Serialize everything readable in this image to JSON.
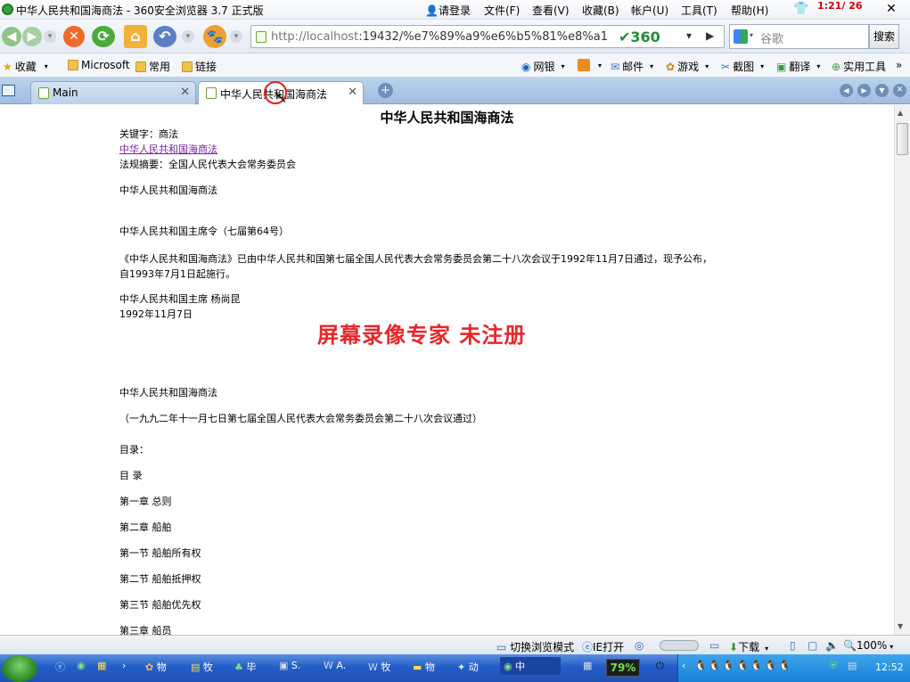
{
  "window": {
    "title": "中华人民共和国海商法 - 360安全浏览器 3.7 正式版",
    "menus": [
      "请登录",
      "文件(F)",
      "查看(V)",
      "收藏(B)",
      "帐户(U)",
      "工具(T)",
      "帮助(H)"
    ],
    "recording_time": "1:21/ 26"
  },
  "navbar": {
    "url_host": "http://localhost",
    "url_rest": ":19432/%e7%89%a9%e6%b5%81%e8%a1",
    "brand": "360",
    "search_placeholder": "谷歌",
    "search_button": "搜索"
  },
  "favorites_bar": {
    "items": [
      "收藏",
      "Microsoft",
      "常用",
      "链接"
    ],
    "right_items": [
      "网银",
      "邮件",
      "游戏",
      "截图",
      "翻译",
      "实用工具"
    ]
  },
  "tabs": [
    {
      "label": "Main",
      "active": false
    },
    {
      "label": "中华人民共和国海商法",
      "active": true
    }
  ],
  "document": {
    "heading": "中华人民共和国海商法",
    "keywords": "关键字：商法",
    "link": "中华人民共和国海商法",
    "summary": "法规摘要：全国人民代表大会常务委员会",
    "lines": [
      "中华人民共和国海商法",
      "中华人民共和国主席令（七届第64号）",
      "《中华人民共和国海商法》已由中华人民共和国第七届全国人民代表大会常务委员会第二十八次会议于1992年11月7日通过，现予公布，",
      "自1993年7月1日起施行。",
      "中华人民共和国主席  杨尚昆",
      "1992年11月7日",
      "中华人民共和国海商法",
      "（一九九二年十一月七日第七届全国人民代表大会常务委员会第二十八次会议通过）",
      "目录：",
      "目  录",
      "第一章  总则",
      "第二章  船舶",
      "第一节  船舶所有权",
      "第二节  船舶抵押权",
      "第三节  船舶优先权",
      "第三章  船员"
    ],
    "watermark": "屏幕录像专家  未注册"
  },
  "statusbar": {
    "switch_mode": "切换浏览模式",
    "ie_open": "IE打开",
    "download": "下载",
    "zoom": "100%"
  },
  "taskbar": {
    "tasks": [
      "物",
      "牧",
      "毕",
      "S.",
      "A.",
      "牧",
      "物",
      "动",
      "中"
    ],
    "battery": "79%",
    "clock": "12:52"
  }
}
